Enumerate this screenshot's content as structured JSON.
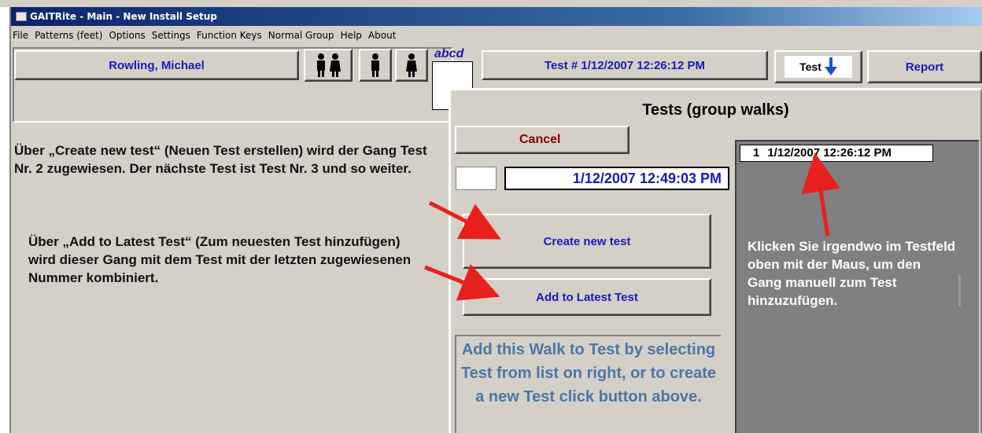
{
  "window": {
    "title": "GAITRite - Main - New Install Setup",
    "app_icon": "app-icon"
  },
  "menu": [
    "File",
    "Patterns (feet)",
    "Options",
    "Settings",
    "Function Keys",
    "Normal Group",
    "Help",
    "About"
  ],
  "toolbar": {
    "patient_name": "Rowling, Michael",
    "abcd_label": "abcd",
    "test_label": "Test # 1/12/2007 12:26:12 PM",
    "test_button_label": "Test",
    "report_label": "Report",
    "group_icons": [
      "couple-icon",
      "man-icon",
      "woman-icon"
    ]
  },
  "dialog": {
    "title": "Tests (group walks)",
    "cancel_label": "Cancel",
    "number_value": "",
    "datetime_value": "1/12/2007 12:49:03 PM",
    "create_label": "Create new test",
    "add_latest_label": "Add to Latest Test",
    "help_text": "Add this Walk to Test  by selecting Test  from list on right, or to create a new Test click button above.",
    "list": [
      {
        "number": "1",
        "datetime": "1/12/2007 12:26:12 PM"
      }
    ]
  },
  "annotations": {
    "create_text": "Über „Create new test“ (Neuen Test erstellen) wird der Gang Test Nr. 2 zugewiesen. Der nächste Test ist Test Nr. 3 und so weiter.",
    "add_text": "Über „Add to Latest Test“ (Zum neuesten Test hinzufügen) wird dieser Gang mit dem Test mit der letzten zugewiesenen Nummer kombiniert.",
    "list_text": "Klicken Sie irgendwo im Testfeld oben mit der Maus, um den Gang manuell zum Test hinzuzufügen."
  },
  "colors": {
    "arrow": "#e8201e",
    "link_text": "#1a1ab8",
    "cancel_text": "#8b0000",
    "help_text": "#4a76a8",
    "list_bg": "#808080"
  }
}
